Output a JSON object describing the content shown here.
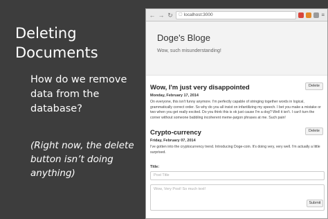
{
  "slide": {
    "title": "Deleting Documents",
    "body": "How do we remove data from the database?",
    "note": "(Right now, the delete button isn’t doing anything)"
  },
  "browser": {
    "url": "localhost:3000",
    "nav": {
      "back": "←",
      "forward": "→",
      "reload": "↻"
    },
    "menu_icon": "≡"
  },
  "page": {
    "blog_title": "Doge's Bloge",
    "blog_subtitle": "Wow, such misunderstanding!",
    "posts": [
      {
        "title": "Wow, I'm just very disappointed",
        "date": "Monday, February 17, 2014",
        "body": "On everyone, this isn't funny anymore. I'm perfectly capable of stringing together words in logical, grammatically correct order. So why do you all insist on infantilizing my speech. I bet you make a mistake or two when you get really excited. Do you think this is ok just cause I'm a dog? Well it isn't. I can't turn the corner without someone babbling incoherent meme-jargon phrases at me. Such pain!",
        "delete_label": "Delete"
      },
      {
        "title": "Crypto-currency",
        "date": "Friday, February 07, 2014",
        "body": "I've gotten into the cryptocurrency trend. Introducing Doge-coin. It's doing very, very well. I'm actually a little surprised.",
        "delete_label": "Delete"
      }
    ],
    "form": {
      "title_label": "Title:",
      "title_placeholder": "Post Title",
      "body_placeholder": "Wow, Very Post! So much text!",
      "submit_label": "Submit"
    }
  }
}
